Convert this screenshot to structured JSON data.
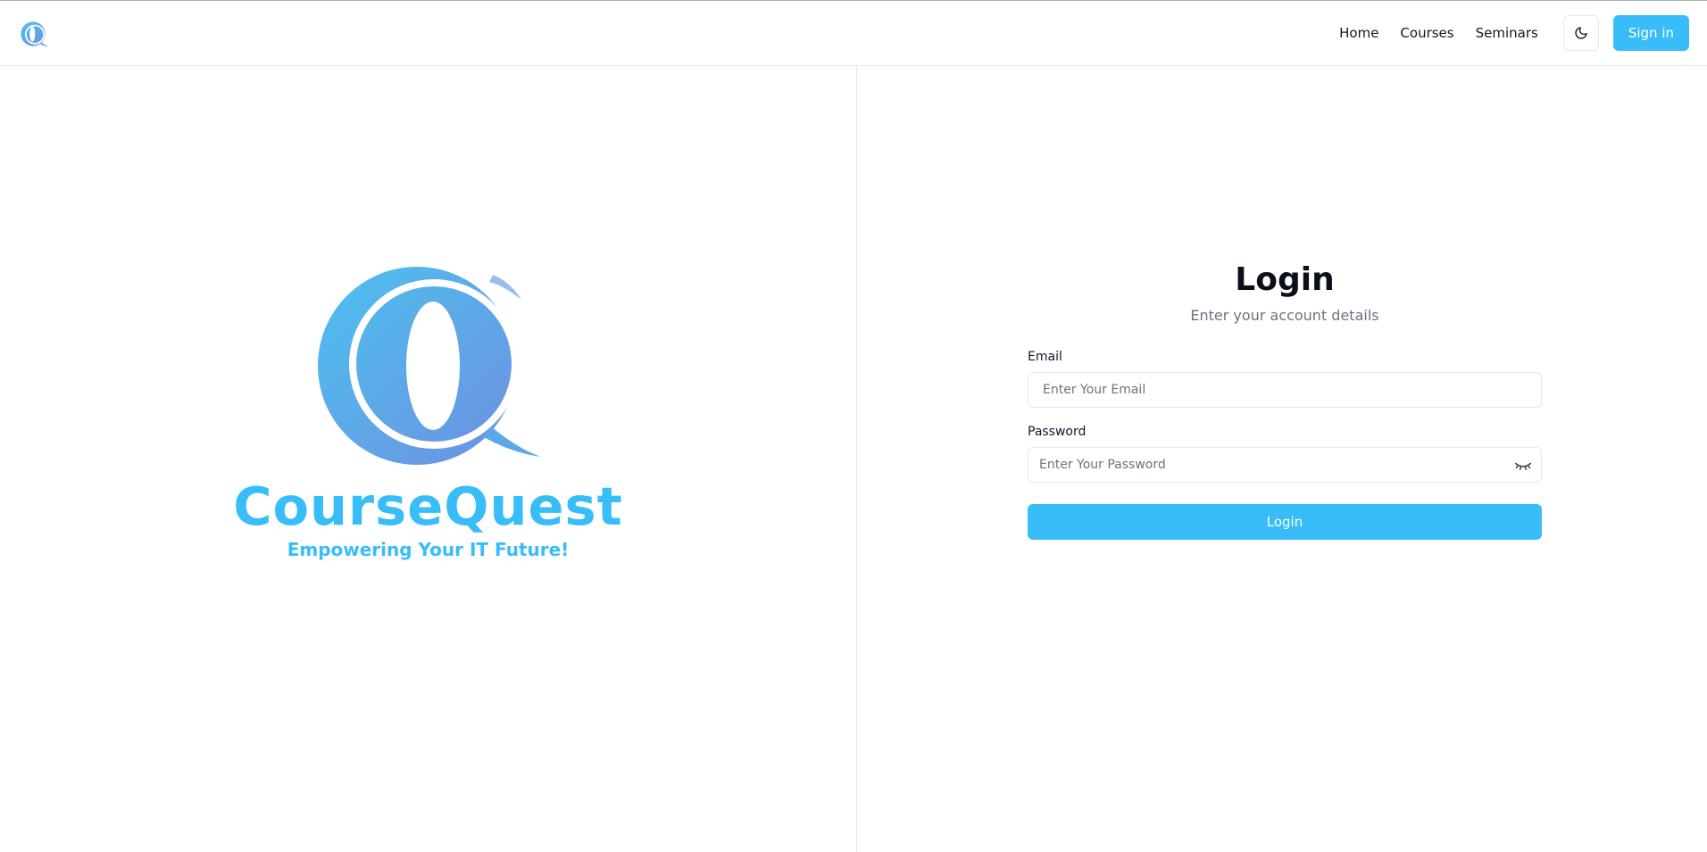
{
  "nav": {
    "links": [
      {
        "label": "Home"
      },
      {
        "label": "Courses"
      },
      {
        "label": "Seminars"
      }
    ],
    "theme_icon": "moon-icon",
    "signin_label": "Sign in"
  },
  "brand": {
    "name": "CourseQuest",
    "tagline": "Empowering Your IT Future!",
    "color": "#38bdf8",
    "gradient": [
      "#4cc1ef",
      "#6f90e0"
    ]
  },
  "login": {
    "title": "Login",
    "subtitle": "Enter your account details",
    "email_label": "Email",
    "email_placeholder": "Enter Your Email",
    "password_label": "Password",
    "password_placeholder": "Enter Your Password",
    "password_icon": "eye-closed-icon",
    "submit_label": "Login"
  },
  "colors": {
    "accent": "#38bdf8",
    "border": "#e5e7eb",
    "muted_text": "#6b7280"
  }
}
